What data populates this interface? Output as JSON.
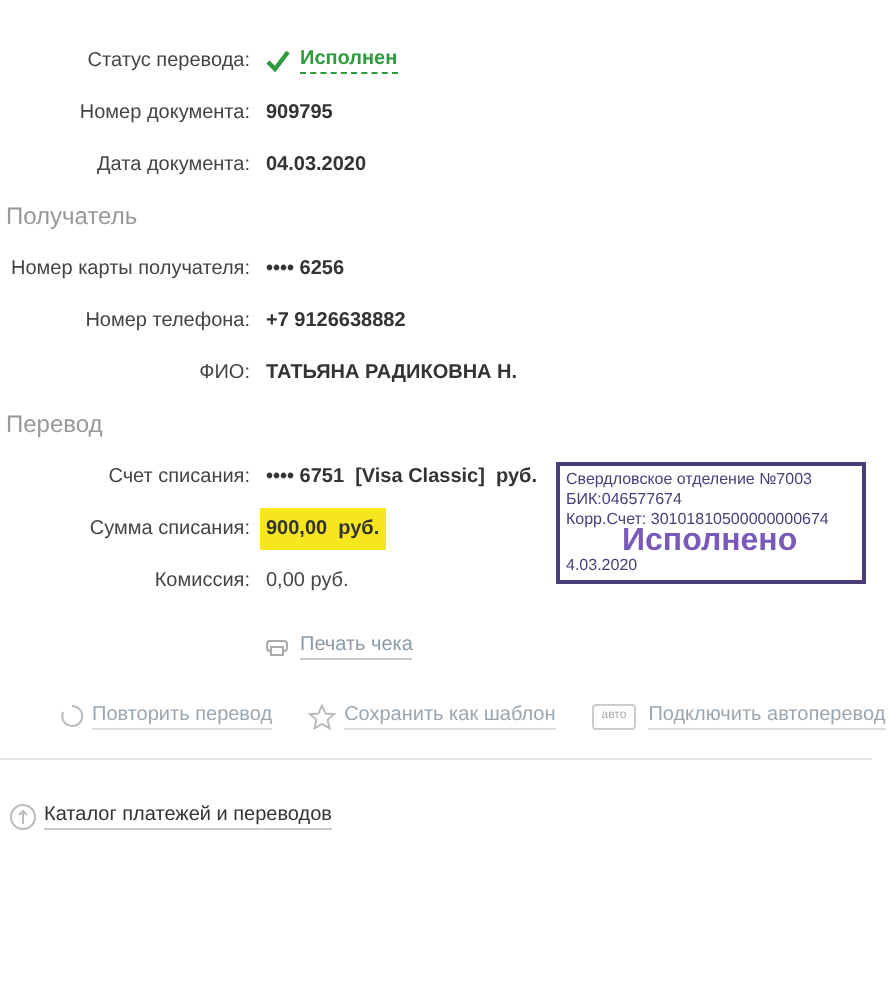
{
  "status_rows": [
    {
      "label": "Статус перевода:",
      "value": "Исполнен",
      "kind": "status"
    },
    {
      "label": "Номер документа:",
      "value": "909795",
      "kind": "text"
    },
    {
      "label": "Дата документа:",
      "value": "04.03.2020",
      "kind": "text"
    }
  ],
  "recipient": {
    "heading": "Получатель",
    "rows": [
      {
        "label": "Номер карты получателя:",
        "value": "•••• 6256",
        "kind": "text"
      },
      {
        "label": "Номер телефона:",
        "value": "+7 9126638882",
        "kind": "text"
      },
      {
        "label": "ФИО:",
        "value": "ТАТЬЯНА РАДИКОВНА Н.",
        "kind": "text"
      }
    ]
  },
  "transfer": {
    "heading": "Перевод",
    "rows": [
      {
        "label": "Счет списания:",
        "value": "•••• 6751  [Visa Classic]  руб.",
        "kind": "text"
      },
      {
        "label": "Сумма списания:",
        "value": "900,00  руб.",
        "kind": "highlight"
      },
      {
        "label": "Комиссия:",
        "value": "0,00 руб.",
        "kind": "plain"
      }
    ]
  },
  "stamp": {
    "lines": [
      "Свердловское отделение №7003",
      "БИК:046577674",
      "Корр.Счет: 30101810500000000674"
    ],
    "title": "Исполнено",
    "date": "4.03.2020"
  },
  "print_link": "Печать чека",
  "actions": [
    {
      "label": "Повторить перевод",
      "kind": "repeat"
    },
    {
      "label": "Сохранить как шаблон",
      "kind": "star"
    },
    {
      "label": "Подключить автоперевод",
      "kind": "auto",
      "badge": "авто"
    }
  ],
  "catalog_link": "Каталог платежей и переводов"
}
